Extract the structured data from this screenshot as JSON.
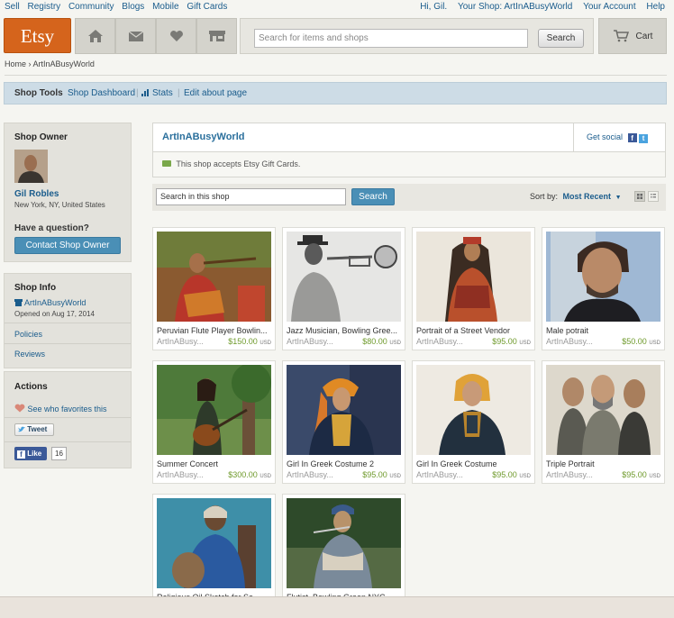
{
  "topnav": {
    "left": [
      "Sell",
      "Registry",
      "Community",
      "Blogs",
      "Mobile",
      "Gift Cards"
    ],
    "greeting": "Hi, Gil.",
    "your_shop": "Your Shop: ArtInABusyWorld",
    "your_account": "Your Account",
    "help": "Help"
  },
  "header": {
    "logo": "Etsy",
    "search_placeholder": "Search for items and shops",
    "search_button": "Search",
    "cart_label": "Cart"
  },
  "breadcrumb": "Home › ArtInABusyWorld",
  "shop_tools": {
    "title": "Shop Tools",
    "dashboard": "Shop Dashboard",
    "stats": "Stats",
    "edit_about": "Edit about page"
  },
  "sidebar": {
    "owner_heading": "Shop Owner",
    "owner_name": "Gil Robles",
    "owner_location": "New York, NY, United States",
    "question": "Have a question?",
    "contact_button": "Contact Shop Owner",
    "info_heading": "Shop Info",
    "shop_name": "ArtInABusyWorld",
    "opened": "Opened on Aug 17, 2014",
    "policies": "Policies",
    "reviews": "Reviews",
    "actions_heading": "Actions",
    "favorites": "See who favorites this",
    "tweet": "Tweet",
    "like": "Like",
    "like_count": "16"
  },
  "shop": {
    "name": "ArtInABusyWorld",
    "get_social": "Get social",
    "gift_cards": "This shop accepts Etsy Gift Cards.",
    "search_value": "Search in this shop",
    "search_button": "Search",
    "sort_label": "Sort by:",
    "sort_value": "Most Recent"
  },
  "items": [
    {
      "title": "Peruvian Flute Player Bowlin...",
      "shop": "ArtInABusy...",
      "price": "$150.00",
      "currency": "USD"
    },
    {
      "title": "Jazz Musician, Bowling Gree...",
      "shop": "ArtInABusy...",
      "price": "$80.00",
      "currency": "USD"
    },
    {
      "title": "Portrait of a Street Vendor",
      "shop": "ArtInABusy...",
      "price": "$95.00",
      "currency": "USD"
    },
    {
      "title": "Male potrait",
      "shop": "ArtInABusy...",
      "price": "$50.00",
      "currency": "USD"
    },
    {
      "title": "Summer Concert",
      "shop": "ArtInABusy...",
      "price": "$300.00",
      "currency": "USD"
    },
    {
      "title": "Girl In Greek Costume 2",
      "shop": "ArtInABusy...",
      "price": "$95.00",
      "currency": "USD"
    },
    {
      "title": "Girl In Greek Costume",
      "shop": "ArtInABusy...",
      "price": "$95.00",
      "currency": "USD"
    },
    {
      "title": "Triple Portrait",
      "shop": "ArtInABusy...",
      "price": "$95.00",
      "currency": "USD"
    },
    {
      "title": "Religious Oil Sketch for Sa...",
      "shop": "",
      "price": "",
      "currency": ""
    },
    {
      "title": "Flutist, Bowling Green NYC...",
      "shop": "",
      "price": "",
      "currency": ""
    }
  ],
  "colors": {
    "brand": "#d5641c",
    "link": "#1a5c8c",
    "price": "#6f9a2c",
    "button": "#4a8fb6"
  }
}
